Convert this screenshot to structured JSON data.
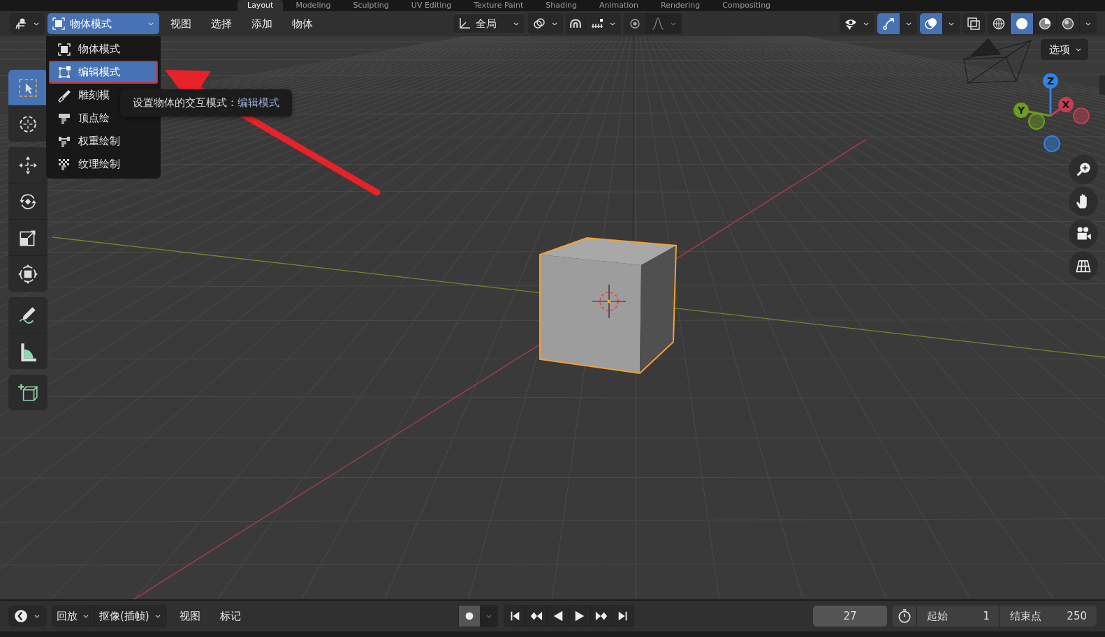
{
  "workspace_tabs": [
    {
      "label": "Layout",
      "selected": true
    },
    {
      "label": "Modeling",
      "selected": false
    },
    {
      "label": "Sculpting",
      "selected": false
    },
    {
      "label": "UV Editing",
      "selected": false
    },
    {
      "label": "Texture Paint",
      "selected": false
    },
    {
      "label": "Shading",
      "selected": false
    },
    {
      "label": "Animation",
      "selected": false
    },
    {
      "label": "Rendering",
      "selected": false
    },
    {
      "label": "Compositing",
      "selected": false
    }
  ],
  "header": {
    "mode_dropdown": {
      "label": "物体模式",
      "open": true
    },
    "menus": [
      "视图",
      "选择",
      "添加",
      "物体"
    ],
    "orientation": {
      "label": "全局"
    },
    "snap_on": false,
    "proportional_on": false,
    "gizmo_on": true,
    "overlay_on": true,
    "xray_on": false,
    "shading": [
      {
        "kind": "wireframe",
        "selected": false
      },
      {
        "kind": "solid",
        "selected": true
      },
      {
        "kind": "material",
        "selected": false
      },
      {
        "kind": "rendered",
        "selected": false
      }
    ]
  },
  "mode_menu": {
    "items": [
      {
        "kind": "object",
        "label": "物体模式",
        "selected": false,
        "annotated": false
      },
      {
        "kind": "edit",
        "label": "编辑模式",
        "selected": true,
        "annotated": true
      },
      {
        "kind": "sculpt",
        "label": "雕刻模",
        "selected": false,
        "annotated": false
      },
      {
        "kind": "vertex_paint",
        "label": "顶点绘",
        "selected": false,
        "annotated": false
      },
      {
        "kind": "weight_paint",
        "label": "权重绘制",
        "selected": false,
        "annotated": false
      },
      {
        "kind": "texture_paint",
        "label": "纹理绘制",
        "selected": false,
        "annotated": false
      }
    ]
  },
  "tooltip": {
    "text": "设置物体的交互模式：",
    "value": "编辑模式"
  },
  "toolbar": {
    "groups": [
      [
        {
          "kind": "select",
          "selected": true
        },
        {
          "kind": "cursor",
          "selected": false
        }
      ],
      [
        {
          "kind": "move",
          "selected": false
        },
        {
          "kind": "rotate",
          "selected": false
        },
        {
          "kind": "scale",
          "selected": false
        },
        {
          "kind": "transform",
          "selected": false
        }
      ],
      [
        {
          "kind": "annotate",
          "selected": false
        },
        {
          "kind": "measure",
          "selected": false
        }
      ],
      [
        {
          "kind": "add_cube",
          "selected": false
        }
      ]
    ]
  },
  "options_button": {
    "label": "选项"
  },
  "gizmo": {
    "axes": [
      {
        "label": "Z",
        "color": "#2f83e3"
      },
      {
        "label": "Y",
        "color": "#6c9d1f"
      },
      {
        "label": "X",
        "color": "#c43e52"
      }
    ]
  },
  "nav_buttons": [
    {
      "kind": "zoom"
    },
    {
      "kind": "pan"
    },
    {
      "kind": "camera"
    },
    {
      "kind": "ortho"
    }
  ],
  "timeline": {
    "playback": "回放",
    "keying": "抠像(插帧)",
    "menus": [
      "视图",
      "标记"
    ],
    "auto_key": false,
    "current_frame": "27",
    "start_label": "起始",
    "start": "1",
    "end_label": "结束点",
    "end": "250"
  }
}
